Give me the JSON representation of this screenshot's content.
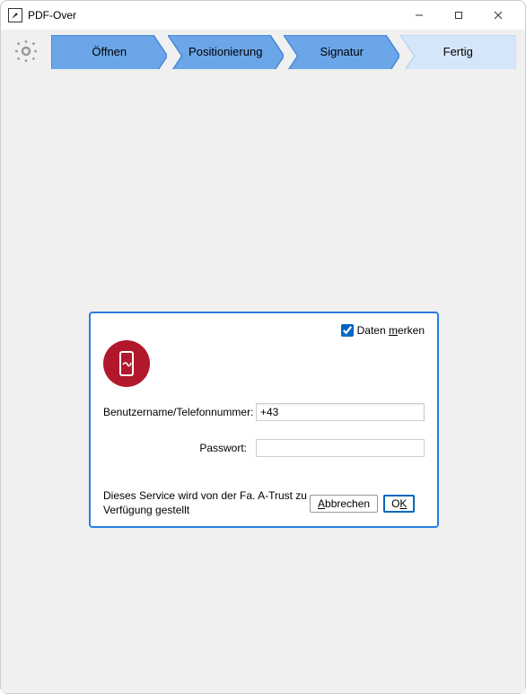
{
  "window": {
    "title": "PDF-Over"
  },
  "stepper": {
    "step1": "Öffnen",
    "step2": "Positionierung",
    "step3": "Signatur",
    "step4": "Fertig"
  },
  "panel": {
    "remember_prefix": "Daten ",
    "remember_mnemonic": "m",
    "remember_suffix": "erken",
    "remember_checked": true,
    "username_label": "Benutzername/Telefonnummer:",
    "username_value": "+43",
    "password_label": "Passwort:",
    "password_value": "",
    "service_text": "Dieses Service wird von der Fa. A-Trust zu Verfügung gestellt",
    "cancel_mnemonic": "A",
    "cancel_suffix": "bbrechen",
    "ok_prefix": "O",
    "ok_mnemonic": "K"
  },
  "colors": {
    "step_active": "#6ba6e8",
    "step_active_border": "#3d7fd0",
    "step_inactive": "#d5e6fb",
    "logo": "#b2182b",
    "accent": "#0067c0"
  }
}
